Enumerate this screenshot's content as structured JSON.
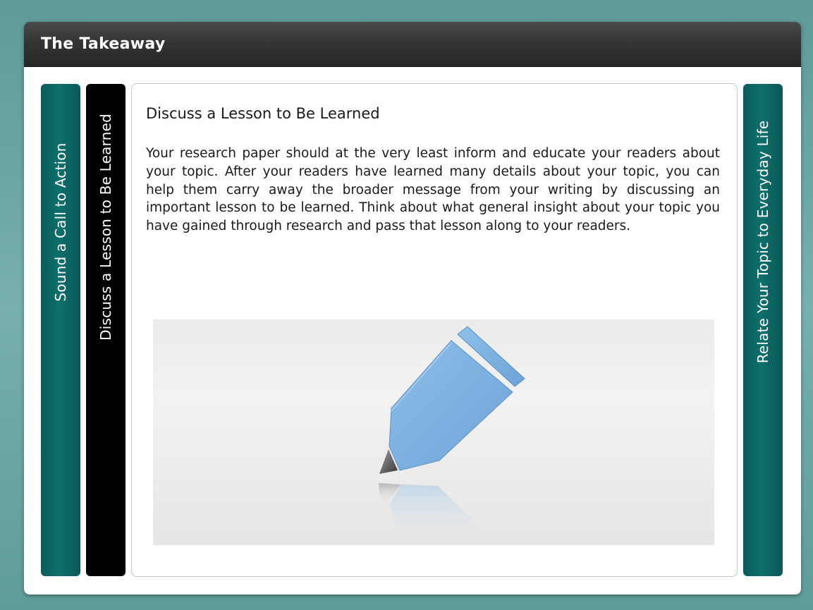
{
  "window": {
    "title": "The Takeaway"
  },
  "tabs": [
    {
      "label": "Sound a Call to Action",
      "active": false
    },
    {
      "label": "Discuss a Lesson to Be Learned",
      "active": true
    },
    {
      "label": "Relate Your Topic to Everyday Life",
      "active": false
    }
  ],
  "content": {
    "heading": "Discuss a Lesson to Be Learned",
    "body": "Your research paper should at the very least inform and educate your readers about your topic. After your readers have learned many details about your topic, you can help them carry away the broader message from your writing by discussing an important lesson to be learned. Think about what general insight about your topic you have gained through research and pass that lesson along to your readers.",
    "illustration_icon": "pencil-icon"
  },
  "colors": {
    "tab_inactive": "#0e6f6b",
    "tab_active": "#000000",
    "titlebar": "#333333",
    "pencil": "#7fb1e0"
  }
}
